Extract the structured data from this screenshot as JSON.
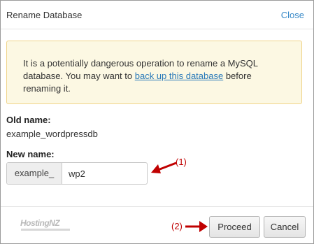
{
  "dialog": {
    "title": "Rename Database",
    "close_label": "Close"
  },
  "alert": {
    "text_before": "It is a potentially dangerous operation to rename a MySQL database. You may want to ",
    "link_text": "back up this database",
    "text_after": " before renaming it."
  },
  "old_name": {
    "label": "Old name:",
    "value": "example_wordpressdb"
  },
  "new_name": {
    "label": "New name:",
    "prefix": "example_",
    "value": "wp2"
  },
  "annotations": {
    "step1": "(1)",
    "step2": "(2)",
    "color": "#c00000"
  },
  "footer": {
    "logo_text": "HostingNZ",
    "proceed_label": "Proceed",
    "cancel_label": "Cancel"
  }
}
